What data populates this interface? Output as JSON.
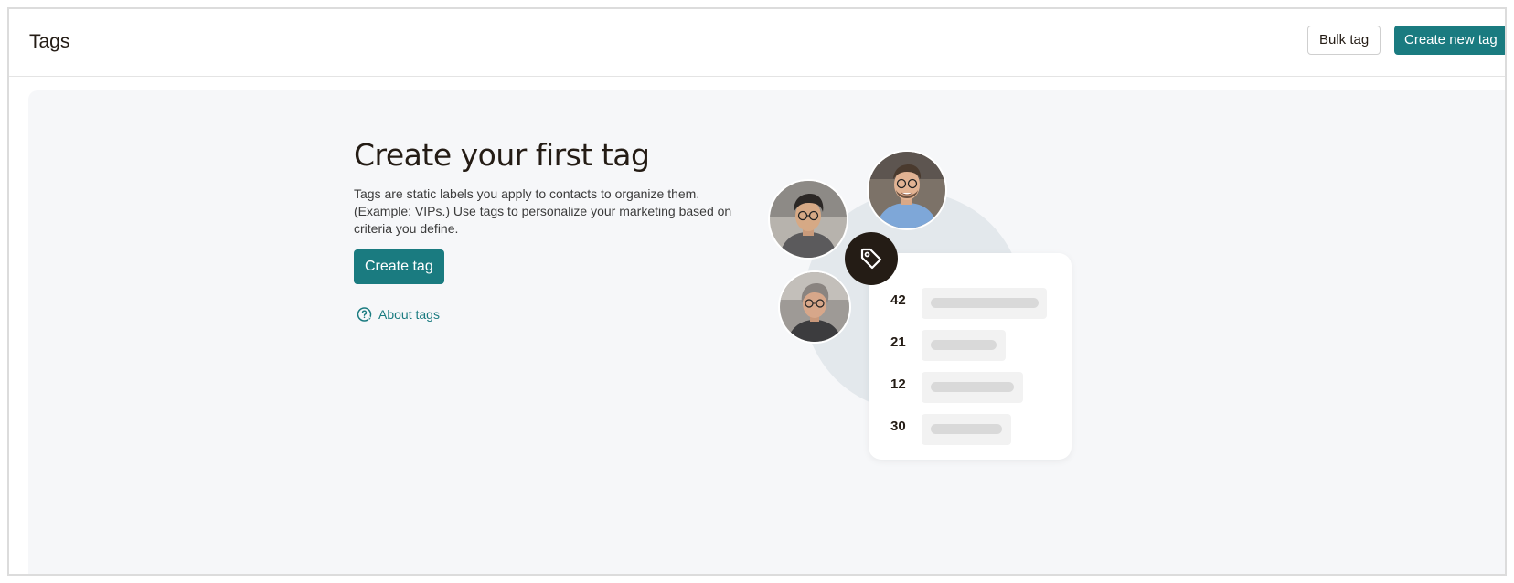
{
  "header": {
    "title": "Tags",
    "bulk_tag_label": "Bulk tag",
    "create_new_tag_label": "Create new tag"
  },
  "empty_state": {
    "heading": "Create your first tag",
    "description": "Tags are static labels you apply to contacts to organize them. (Example: VIPs.) Use tags to personalize your marketing based on criteria you define.",
    "create_tag_label": "Create tag",
    "about_tags_label": "About tags"
  },
  "illustration": {
    "counts": [
      "42",
      "21",
      "12",
      "30"
    ],
    "icons": [
      "tag-icon"
    ]
  },
  "colors": {
    "accent": "#1a7b80",
    "panel_bg": "#f6f7f9",
    "dark": "#241c15"
  }
}
